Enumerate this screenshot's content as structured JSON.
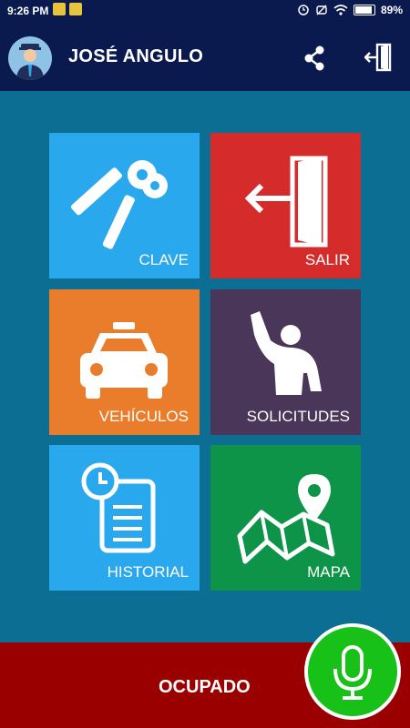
{
  "status_bar": {
    "time": "9:26 PM",
    "battery": "89%",
    "battery_level": 0.89,
    "icons": [
      "notification-icon",
      "notification-icon",
      "alarm-icon",
      "mute-icon",
      "wifi-icon",
      "battery-icon"
    ]
  },
  "header": {
    "user_name": "JOSÉ ANGULO",
    "avatar_icon": "driver-avatar-icon",
    "actions": [
      {
        "name": "share",
        "icon": "share-icon"
      },
      {
        "name": "logout",
        "icon": "exit-door-icon"
      }
    ]
  },
  "tiles": [
    {
      "label": "CLAVE",
      "icon": "keys-icon",
      "color": "#29a8ee"
    },
    {
      "label": "SALIR",
      "icon": "exit-door-icon",
      "color": "#d62b2b"
    },
    {
      "label": "VEHÍCULOS",
      "icon": "taxi-icon",
      "color": "#ea7d2c"
    },
    {
      "label": "SOLICITUDES",
      "icon": "person-waving-icon",
      "color": "#4a3658"
    },
    {
      "label": "HISTORIAL",
      "icon": "history-icon",
      "color": "#29a8ee"
    },
    {
      "label": "MAPA",
      "icon": "map-icon",
      "color": "#0e9448"
    }
  ],
  "bottom": {
    "status": "OCUPADO",
    "status_color": "#9a0000",
    "mic_icon": "microphone-icon",
    "mic_color": "#17c117"
  },
  "background_color": "#0d6e93",
  "header_color": "#0a1a4e"
}
